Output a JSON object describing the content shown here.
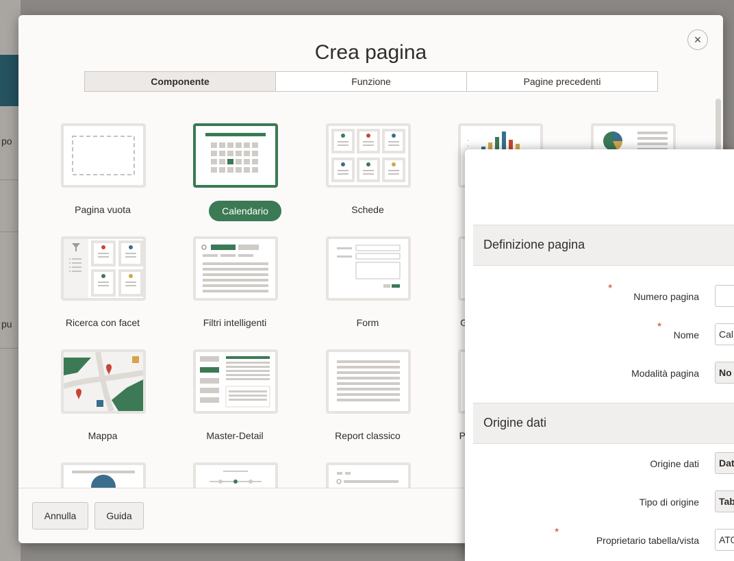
{
  "background": {
    "left_labels": [
      "po",
      "pu"
    ]
  },
  "dialog": {
    "title": "Crea pagina",
    "close_glyph": "×",
    "tabs": [
      {
        "label": "Componente",
        "active": true
      },
      {
        "label": "Funzione",
        "active": false
      },
      {
        "label": "Pagine precedenti",
        "active": false
      }
    ],
    "tiles": [
      {
        "label": "Pagina vuota",
        "icon": "blank-page-icon"
      },
      {
        "label": "Calendario",
        "icon": "calendar-icon",
        "selected": true
      },
      {
        "label": "Schede",
        "icon": "cards-icon"
      },
      {
        "label": "",
        "icon": "chart-icon"
      },
      {
        "label": "",
        "icon": "dashboard-icon"
      },
      {
        "label": "Ricerca con facet",
        "icon": "faceted-search-icon"
      },
      {
        "label": "Filtri intelligenti",
        "icon": "smart-filters-icon"
      },
      {
        "label": "Form",
        "icon": "form-icon"
      },
      {
        "label": "G",
        "icon": "grid-icon"
      },
      {
        "label": "Mappa",
        "icon": "map-icon"
      },
      {
        "label": "Master-Detail",
        "icon": "master-detail-icon"
      },
      {
        "label": "Report classico",
        "icon": "classic-report-icon"
      },
      {
        "label": "P",
        "icon": "partial-icon"
      }
    ],
    "footer": {
      "cancel_label": "Annulla",
      "help_label": "Guida"
    }
  },
  "wizard": {
    "sections": [
      {
        "title": "Definizione pagina"
      },
      {
        "title": "Origine dati"
      }
    ],
    "fields": {
      "page_number": {
        "label": "Numero pagina",
        "value": "",
        "required": true
      },
      "name": {
        "label": "Nome",
        "value": "Cal",
        "required": true
      },
      "page_mode": {
        "label": "Modalità pagina",
        "value": "No"
      },
      "data_source": {
        "label": "Origine dati",
        "value": "Dat"
      },
      "source_type": {
        "label": "Tipo di origine",
        "value": "Tab"
      },
      "table_owner": {
        "label": "Proprietario tabella/vista",
        "value": "AT0",
        "required": true
      }
    }
  },
  "colors": {
    "accent": "#3b7a55",
    "required": "#c74634",
    "teal": "#24525e"
  }
}
